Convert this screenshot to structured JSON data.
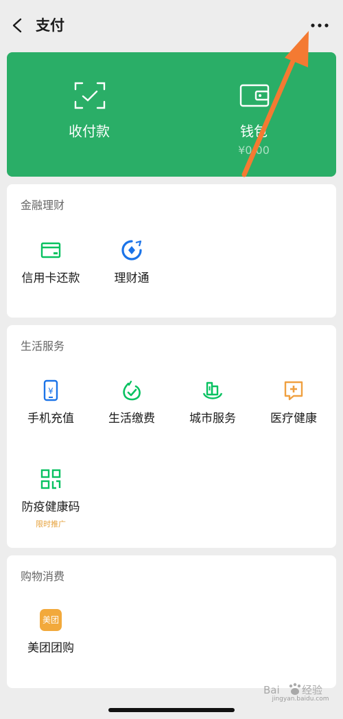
{
  "header": {
    "title": "支付"
  },
  "hero": {
    "items": [
      {
        "label": "收付款"
      },
      {
        "label": "钱包",
        "balance": "¥0.00"
      }
    ]
  },
  "sections": [
    {
      "title": "金融理财",
      "items": [
        {
          "label": "信用卡还款"
        },
        {
          "label": "理财通"
        }
      ]
    },
    {
      "title": "生活服务",
      "items": [
        {
          "label": "手机充值"
        },
        {
          "label": "生活缴费"
        },
        {
          "label": "城市服务"
        },
        {
          "label": "医疗健康"
        },
        {
          "label": "防疫健康码",
          "tag": "限时推广"
        }
      ]
    },
    {
      "title": "购物消费",
      "items": [
        {
          "label": "美团团购",
          "icon_text": "美团"
        }
      ]
    }
  ],
  "watermark": {
    "text": "jingyan.baidu.com"
  },
  "colors": {
    "brand_green": "#2aae67",
    "icon_green": "#07c160",
    "blue": "#1a73e8",
    "orange": "#f0a040",
    "annotation_arrow": "#f47a32"
  }
}
